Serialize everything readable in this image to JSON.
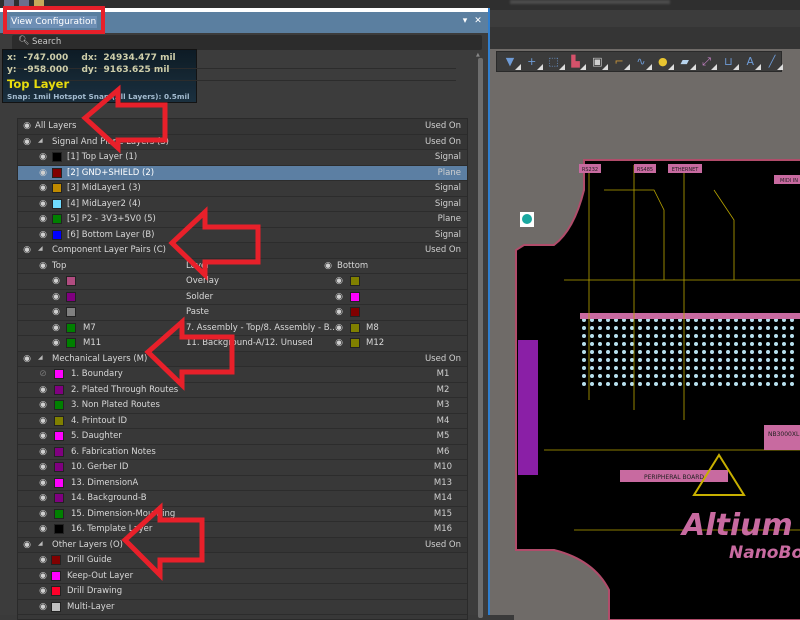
{
  "window": {
    "title": ""
  },
  "panel": {
    "title": "View Configuration",
    "menu_button": "▾",
    "close_button": "✕",
    "search_placeholder": "Search"
  },
  "hud": {
    "x_label": "x:",
    "x_value": "-747.000",
    "dx_label": "dx:",
    "dx_value": "24934.477 mil",
    "y_label": "y:",
    "y_value": "-958.000",
    "dy_label": "dy:",
    "dy_value": "9163.625 mil",
    "layer": "Top Layer",
    "snap": "Snap: 1mil Hotspot Snap (All Layers): 0.5mil"
  },
  "tree": {
    "all_layers": {
      "label": "All Layers",
      "used_on": "Used On"
    },
    "signal": {
      "label": "Signal And Plane Layers (S)",
      "used_on": "Used On",
      "items": [
        {
          "label": "[1] Top Layer (1)",
          "color": "#000000",
          "used_on": "Signal",
          "selected": false
        },
        {
          "label": "[2] GND+SHIELD (2)",
          "color": "#800000",
          "used_on": "Plane",
          "selected": true
        },
        {
          "label": "[3] MidLayer1 (3)",
          "color": "#c08a00",
          "used_on": "Signal",
          "selected": false
        },
        {
          "label": "[4] MidLayer2 (4)",
          "color": "#70dcff",
          "used_on": "Signal",
          "selected": false
        },
        {
          "label": "[5] P2 - 3V3+5V0 (5)",
          "color": "#008000",
          "used_on": "Plane",
          "selected": false
        },
        {
          "label": "[6] Bottom Layer (B)",
          "color": "#0000ff",
          "used_on": "Signal",
          "selected": false
        }
      ]
    },
    "component": {
      "label": "Component Layer Pairs (C)",
      "used_on": "Used On",
      "top_header": "Top",
      "layer_header": "Layer",
      "bottom_header": "Bottom",
      "pairs": [
        {
          "top_color": "#b04c80",
          "top_code": "",
          "layer": "Overlay",
          "bottom_color": "#808000",
          "bottom_code": ""
        },
        {
          "top_color": "#800080",
          "top_code": "",
          "layer": "Solder",
          "bottom_color": "#ff00ff",
          "bottom_code": ""
        },
        {
          "top_color": "#808080",
          "top_code": "",
          "layer": "Paste",
          "bottom_color": "#800000",
          "bottom_code": ""
        },
        {
          "top_color": "#008000",
          "top_code": "M7",
          "layer": "7. Assembly - Top/8. Assembly - B...",
          "bottom_color": "#808000",
          "bottom_code": "M8"
        },
        {
          "top_color": "#008000",
          "top_code": "M11",
          "layer": "11. Background-A/12. Unused",
          "bottom_color": "#808000",
          "bottom_code": "M12"
        }
      ]
    },
    "mechanical": {
      "label": "Mechanical Layers (M)",
      "used_on": "Used On",
      "items": [
        {
          "label": "1. Boundary",
          "color": "#ff00ff",
          "used_on": "M1",
          "visible": false
        },
        {
          "label": "2. Plated Through Routes",
          "color": "#800080",
          "used_on": "M2",
          "visible": true
        },
        {
          "label": "3. Non Plated Routes",
          "color": "#008000",
          "used_on": "M3",
          "visible": true
        },
        {
          "label": "4. Printout ID",
          "color": "#808000",
          "used_on": "M4",
          "visible": true
        },
        {
          "label": "5. Daughter",
          "color": "#ff00ff",
          "used_on": "M5",
          "visible": true
        },
        {
          "label": "6. Fabrication Notes",
          "color": "#800080",
          "used_on": "M6",
          "visible": true
        },
        {
          "label": "10. Gerber ID",
          "color": "#800080",
          "used_on": "M10",
          "visible": true
        },
        {
          "label": "13. DimensionA",
          "color": "#ff00ff",
          "used_on": "M13",
          "visible": true
        },
        {
          "label": "14. Background-B",
          "color": "#800080",
          "used_on": "M14",
          "visible": true
        },
        {
          "label": "15. Dimension-Mounting",
          "color": "#008000",
          "used_on": "M15",
          "visible": true
        },
        {
          "label": "16. Template Layer",
          "color": "#000000",
          "used_on": "M16",
          "visible": true
        }
      ]
    },
    "other": {
      "label": "Other Layers (O)",
      "used_on": "Used On",
      "items": [
        {
          "label": "Drill Guide",
          "color": "#800000"
        },
        {
          "label": "Keep-Out Layer",
          "color": "#ff00ff"
        },
        {
          "label": "Drill Drawing",
          "color": "#ff002a"
        },
        {
          "label": "Multi-Layer",
          "color": "#c0c0c0"
        }
      ]
    }
  },
  "toolbar": {
    "tools": [
      {
        "name": "filter",
        "glyph": "▼",
        "color": "#6e9bd6"
      },
      {
        "name": "move",
        "glyph": "+",
        "color": "#6e9bd6"
      },
      {
        "name": "select-rect",
        "glyph": "⬚",
        "color": "#6e9bd6"
      },
      {
        "name": "align",
        "glyph": "▙",
        "color": "#d6526b"
      },
      {
        "name": "component",
        "glyph": "▣",
        "color": "#cfcfcf"
      },
      {
        "name": "route",
        "glyph": "⌐",
        "color": "#c8943a"
      },
      {
        "name": "interactive-diff",
        "glyph": "∿",
        "color": "#6e9bd6"
      },
      {
        "name": "via",
        "glyph": "●",
        "color": "#e8c430"
      },
      {
        "name": "polygon",
        "glyph": "▰",
        "color": "#b8d4ee"
      },
      {
        "name": "dimension",
        "glyph": "⤢",
        "color": "#c884c8"
      },
      {
        "name": "room",
        "glyph": "⊔",
        "color": "#6e9bd6"
      },
      {
        "name": "string",
        "glyph": "A",
        "color": "#6e9bd6"
      },
      {
        "name": "line",
        "glyph": "╱",
        "color": "#6e9bd6"
      }
    ]
  },
  "pcb": {
    "labels": [
      "RS232",
      "RS485",
      "ETHERNET",
      "MIDI IN",
      "PERIPHERAL BOARD",
      "NB3000XL",
      "Altium",
      "NanoBoard"
    ]
  },
  "annotation_color": "#e8202a"
}
